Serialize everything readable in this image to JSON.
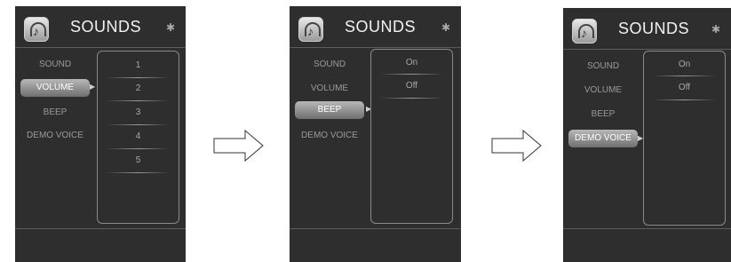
{
  "screens": [
    {
      "title": "SOUNDS",
      "bluetooth_icon": "bluetooth-icon",
      "menu": [
        "SOUND",
        "VOLUME",
        "BEEP",
        "DEMO VOICE"
      ],
      "selected": "VOLUME",
      "options": [
        "1",
        "2",
        "3",
        "4",
        "5"
      ]
    },
    {
      "title": "SOUNDS",
      "bluetooth_icon": "bluetooth-icon",
      "menu": [
        "SOUND",
        "VOLUME",
        "BEEP",
        "DEMO VOICE"
      ],
      "selected": "BEEP",
      "options": [
        "On",
        "Off"
      ]
    },
    {
      "title": "SOUNDS",
      "bluetooth_icon": "bluetooth-icon",
      "menu": [
        "SOUND",
        "VOLUME",
        "BEEP",
        "DEMO VOICE"
      ],
      "selected": "DEMO VOICE",
      "options": [
        "On",
        "Off"
      ]
    }
  ],
  "colors": {
    "screen_bg": "#2e2e2e",
    "selected_bg": "#9a9a9a",
    "text_dim": "#9a9a9a"
  }
}
